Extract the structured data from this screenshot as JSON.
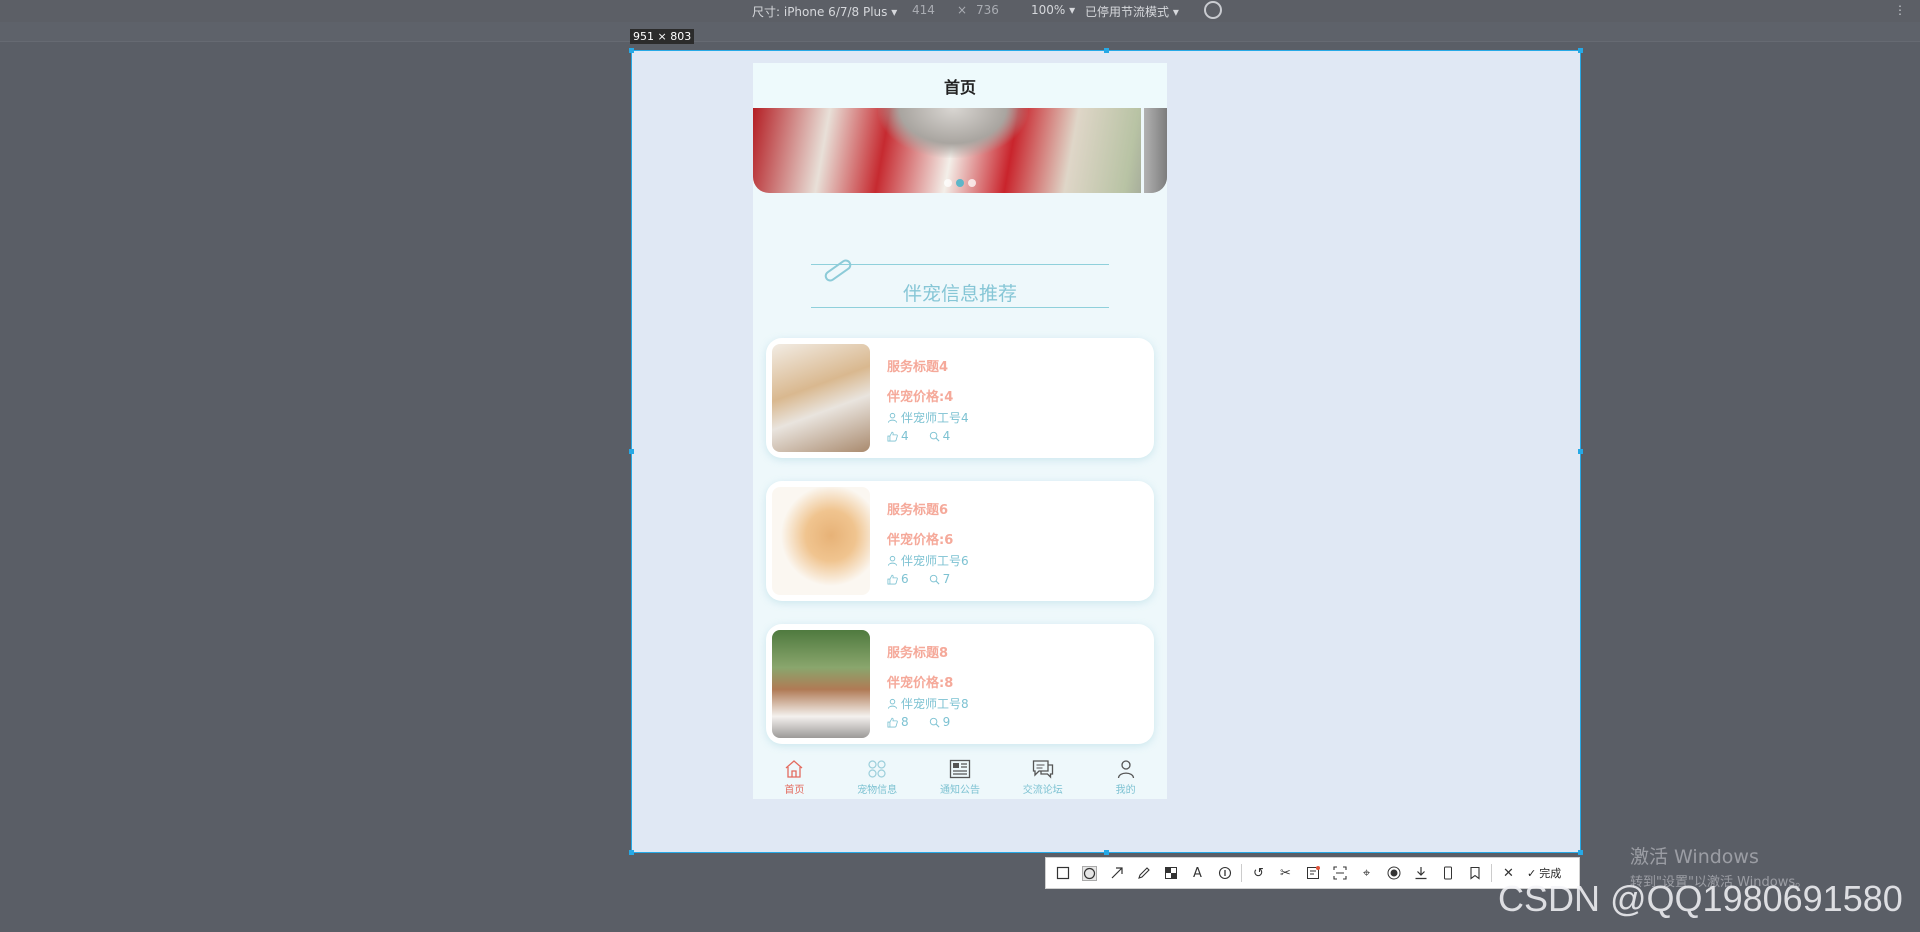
{
  "devtools": {
    "device": "尺寸: iPhone 6/7/8 Plus",
    "width": "414",
    "times": "×",
    "height": "736",
    "zoom": "100%",
    "throttle": "已停用节流模式",
    "more": "⋮"
  },
  "capture": {
    "size_label": "951 × 803"
  },
  "app": {
    "nav_title": "首页",
    "banner": {
      "slide_count": 3,
      "active_index": 1
    },
    "section_title": "伴宠信息推荐",
    "cards": [
      {
        "title": "服务标题4",
        "price": "伴宠价格:4",
        "staff": "伴宠师工号4",
        "likes": "4",
        "views": "4",
        "image_icon": "corgi-photo"
      },
      {
        "title": "服务标题6",
        "price": "伴宠价格:6",
        "staff": "伴宠师工号6",
        "likes": "6",
        "views": "7",
        "image_icon": "cats-photo"
      },
      {
        "title": "服务标题8",
        "price": "伴宠价格:8",
        "staff": "伴宠师工号8",
        "likes": "8",
        "views": "9",
        "image_icon": "poodles-photo"
      }
    ],
    "tabs": [
      {
        "label": "首页",
        "icon": "home-icon",
        "active": true
      },
      {
        "label": "宠物信息",
        "icon": "grid-icon",
        "active": false
      },
      {
        "label": "通知公告",
        "icon": "news-icon",
        "active": false
      },
      {
        "label": "交流论坛",
        "icon": "chat-icon",
        "active": false
      },
      {
        "label": "我的",
        "icon": "person-icon",
        "active": false
      }
    ]
  },
  "toolbar": {
    "done_label": "完成"
  },
  "watermarks": {
    "windows_line1": "激活 Windows",
    "windows_line2": "转到\"设置\"以激活 Windows。",
    "csdn": "CSDN @QQ1980691580"
  },
  "colors": {
    "accent": "#7dc2d2",
    "price": "#f5a99a",
    "active_tab": "#e36b5f",
    "selection": "#26a9e6"
  }
}
